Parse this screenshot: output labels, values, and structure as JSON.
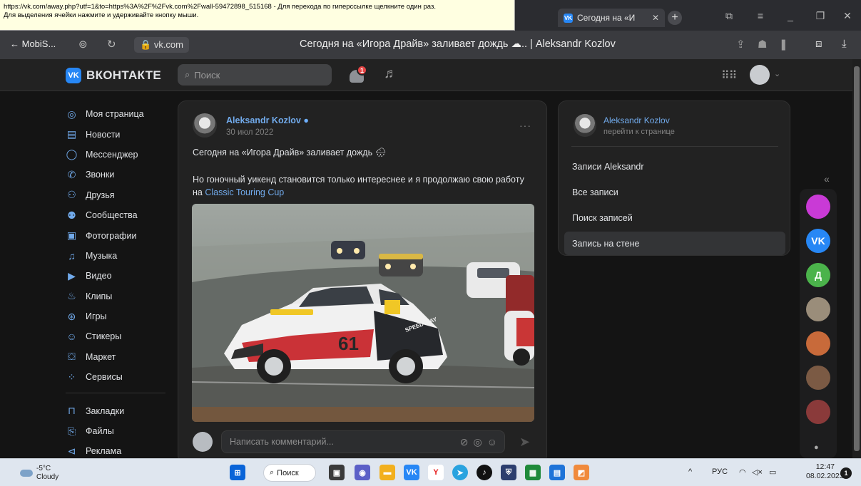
{
  "tooltip": {
    "line1": "https://vk.com/away.php?utf=1&to=https%3A%2F%2Fvk.com%2Fwall-59472898_515168 - Для перехода по гиперссылке щелкните один раз.",
    "line2": "Для выделения ячейки нажмите и удерживайте кнопку мыши."
  },
  "browser": {
    "tab_title": "Сегодня на «И",
    "back_label": "← MobiS...",
    "domain": "vk.com",
    "page_title": "Сегодня на «Игора Драйв» заливает дождь ☁.. | Aleksandr Kozlov"
  },
  "vk": {
    "logo_text": "ВКОНТАКТЕ",
    "logo_mark": "VK",
    "search_placeholder": "Поиск",
    "notif_count": "1"
  },
  "nav": {
    "group1": [
      {
        "icon": "user-circle-icon",
        "glyph": "◎",
        "label": "Моя страница"
      },
      {
        "icon": "news-icon",
        "glyph": "▤",
        "label": "Новости"
      },
      {
        "icon": "messenger-icon",
        "glyph": "◯",
        "label": "Мессенджер"
      },
      {
        "icon": "phone-icon",
        "glyph": "✆",
        "label": "Звонки"
      },
      {
        "icon": "friends-icon",
        "glyph": "⚇",
        "label": "Друзья"
      },
      {
        "icon": "communities-icon",
        "glyph": "⚉",
        "label": "Сообщества"
      },
      {
        "icon": "photos-icon",
        "glyph": "▣",
        "label": "Фотографии"
      },
      {
        "icon": "music-icon",
        "glyph": "♫",
        "label": "Музыка"
      },
      {
        "icon": "video-icon",
        "glyph": "▶",
        "label": "Видео"
      },
      {
        "icon": "clips-icon",
        "glyph": "♨",
        "label": "Клипы"
      },
      {
        "icon": "games-icon",
        "glyph": "⊛",
        "label": "Игры"
      },
      {
        "icon": "stickers-icon",
        "glyph": "☺",
        "label": "Стикеры"
      },
      {
        "icon": "market-icon",
        "glyph": "⛋",
        "label": "Маркет"
      },
      {
        "icon": "services-icon",
        "glyph": "⁘",
        "label": "Сервисы"
      }
    ],
    "group2": [
      {
        "icon": "bookmarks-icon",
        "glyph": "⊓",
        "label": "Закладки"
      },
      {
        "icon": "files-icon",
        "glyph": "⎘",
        "label": "Файлы"
      },
      {
        "icon": "ads-icon",
        "glyph": "⊲",
        "label": "Реклама"
      }
    ]
  },
  "post": {
    "author": "Aleksandr Kozlov",
    "date": "30 июл 2022",
    "more": "···",
    "text1": "Сегодня на «Игора Драйв» заливает дождь 🌧",
    "text2_prefix": "Но гоночный уикенд становится только интереснее и я продолжаю свою работу на ",
    "text2_link": "Classic Touring Cup",
    "car_number": "61",
    "car_sponsor": "SPEED WAY",
    "comment_placeholder": "Написать комментарий..."
  },
  "side_panel": {
    "name": "Aleksandr Kozlov",
    "sub": "перейти к странице",
    "items": [
      "Записи Aleksandr",
      "Все записи",
      "Поиск записей",
      "Запись на стене"
    ],
    "active_index": 3
  },
  "dock": {
    "collapse": "«",
    "items": [
      {
        "name": "vk-music-app-icon",
        "label": "",
        "color": "#c93ad6"
      },
      {
        "name": "vk-app-icon",
        "label": "VK",
        "color": "#2787f5"
      },
      {
        "name": "contact-d-avatar",
        "label": "Д",
        "color": "#4bb34b"
      },
      {
        "name": "contact-avatar-1",
        "label": "",
        "color": "#9a8d7a"
      },
      {
        "name": "contact-avatar-2",
        "label": "",
        "color": "#c86a3a"
      },
      {
        "name": "contact-avatar-3",
        "label": "",
        "color": "#7b5a44"
      },
      {
        "name": "contact-avatar-4",
        "label": "",
        "color": "#8a3a3a"
      }
    ]
  },
  "taskbar": {
    "temp": "-5°C",
    "condition": "Cloudy",
    "search_label": "Поиск",
    "lang": "РУС",
    "time": "12:47",
    "date": "08.02.2023",
    "notif_count": "1"
  }
}
